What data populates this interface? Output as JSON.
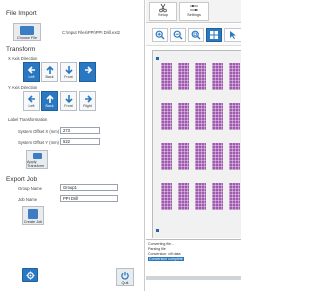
{
  "file_import": {
    "title": "File Import",
    "choose_file_label": "Choose File",
    "file_path": "C:\\Input Files\\PPI\\PPI Drill.ext2"
  },
  "transform": {
    "title": "Transform",
    "x_axis_label": "X Axis Direction",
    "x_buttons": [
      {
        "label": "Left",
        "icon": "arrow-left-icon"
      },
      {
        "label": "Back",
        "icon": "arrow-up-icon"
      },
      {
        "label": "Front",
        "icon": "arrow-down-icon"
      },
      {
        "label": "",
        "icon": "arrow-right-icon"
      }
    ],
    "y_axis_label": "Y Axis Direction",
    "y_buttons": [
      {
        "label": "Left",
        "icon": "arrow-left-icon"
      },
      {
        "label": "Back",
        "icon": "arrow-up-icon"
      },
      {
        "label": "Front",
        "icon": "arrow-down-icon"
      },
      {
        "label": "Right",
        "icon": "arrow-right-icon"
      }
    ],
    "label_transformation": "Label Transformation",
    "offset_x_label": "System Offset X (mm)",
    "offset_x_value": "273",
    "offset_y_label": "System Offset Y (mm)",
    "offset_y_value": "522",
    "apply_label": "Apply Transform"
  },
  "export_job": {
    "title": "Export Job",
    "group_name_label": "Group Name",
    "group_name_value": "Group1",
    "job_name_label": "Job Name",
    "job_name_value": "PPI Drill",
    "create_job_label": "Create Job"
  },
  "bottom": {
    "settings_icon": "gear-icon",
    "quit_label": "Quit",
    "quit_icon": "power-icon"
  },
  "tabs": [
    {
      "label": "Setup",
      "icon": "scissors-icon"
    },
    {
      "label": "Settings",
      "icon": "sliders-icon"
    }
  ],
  "toolbar": {
    "buttons": [
      "zoom-in-icon",
      "zoom-out-icon",
      "zoom-fit-icon",
      "grid-icon",
      "cursor-icon"
    ]
  },
  "log": [
    "Converting file...",
    "Parsing file",
    "Conversion: xlif data",
    "Conversion complete"
  ],
  "colors": {
    "accent": "#2b78c2",
    "grid_fill": "#a05bb0",
    "canvas_bg": "#f1f1f1"
  }
}
